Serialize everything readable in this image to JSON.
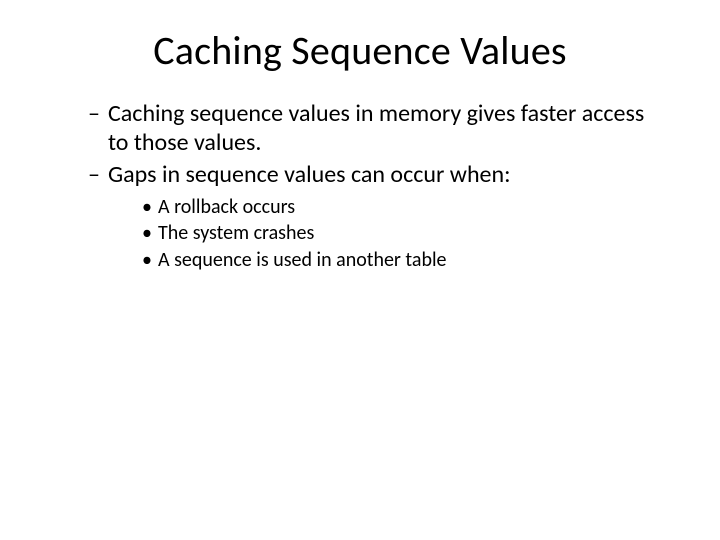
{
  "title": "Caching Sequence Values",
  "bullets": [
    {
      "text": "Caching sequence values in memory gives faster access to those values."
    },
    {
      "text": "Gaps in sequence values can occur when:"
    }
  ],
  "subbullets": [
    {
      "text": "A rollback occurs"
    },
    {
      "text": "The system crashes"
    },
    {
      "text": "A sequence is used in another table"
    }
  ]
}
